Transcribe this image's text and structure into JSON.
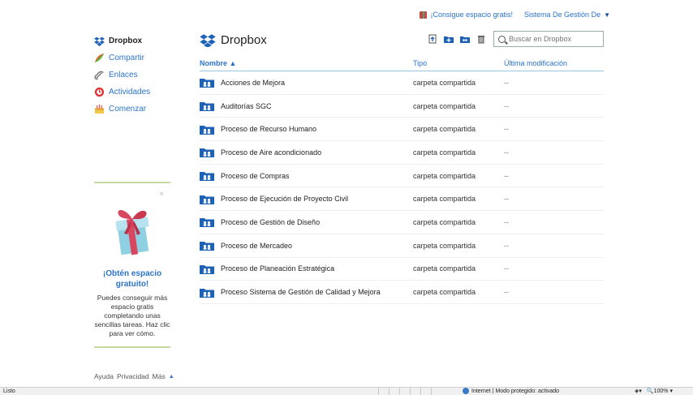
{
  "topbar": {
    "promo_label": "¡Consigue espacio gratis!",
    "user_label": "Sistema De Gestión De"
  },
  "sidebar": {
    "items": [
      {
        "label": "Dropbox",
        "icon": "dropbox-icon"
      },
      {
        "label": "Compartir",
        "icon": "share-icon"
      },
      {
        "label": "Enlaces",
        "icon": "link-icon"
      },
      {
        "label": "Actividades",
        "icon": "activity-icon"
      },
      {
        "label": "Comenzar",
        "icon": "start-icon"
      }
    ]
  },
  "promo": {
    "close": "×",
    "title": "¡Obtén espacio gratuito!",
    "text": "Puedes conseguir más espacio gratis completando unas sencillas tareas. Haz clic para ver cómo."
  },
  "footer": {
    "help": "Ayuda",
    "privacy": "Privacidad",
    "more": "Más"
  },
  "main": {
    "title": "Dropbox",
    "search_placeholder": "Buscar en Dropbox",
    "columns": {
      "name": "Nombre ▲",
      "type": "Tipo",
      "modified": "Última modificación"
    },
    "rows": [
      {
        "name": "Acciones de Mejora",
        "type": "carpeta compartida",
        "modified": "--"
      },
      {
        "name": "Auditorías SGC",
        "type": "carpeta compartida",
        "modified": "--"
      },
      {
        "name": "Proceso de  Recurso Humano",
        "type": "carpeta compartida",
        "modified": "--"
      },
      {
        "name": "Proceso de Aire acondicionado",
        "type": "carpeta compartida",
        "modified": "--"
      },
      {
        "name": "Proceso de Compras",
        "type": "carpeta compartida",
        "modified": "--"
      },
      {
        "name": "Proceso de Ejecución de Proyecto Civil",
        "type": "carpeta compartida",
        "modified": "--"
      },
      {
        "name": "Proceso de Gestión de Diseño",
        "type": "carpeta compartida",
        "modified": "--"
      },
      {
        "name": "Proceso de Mercadeo",
        "type": "carpeta compartida",
        "modified": "--"
      },
      {
        "name": "Proceso de Planeación Estratégica",
        "type": "carpeta compartida",
        "modified": "--"
      },
      {
        "name": "Proceso Sistema de Gestión de Calidad y Mejora",
        "type": "carpeta compartida",
        "modified": "--"
      }
    ]
  },
  "statusbar": {
    "left": "Listo",
    "zone": "Internet | Modo protegido: activado",
    "zoom": "100%"
  },
  "colors": {
    "link": "#2b74c9",
    "folder": "#1d62b7",
    "rule": "#c6d9a0"
  }
}
